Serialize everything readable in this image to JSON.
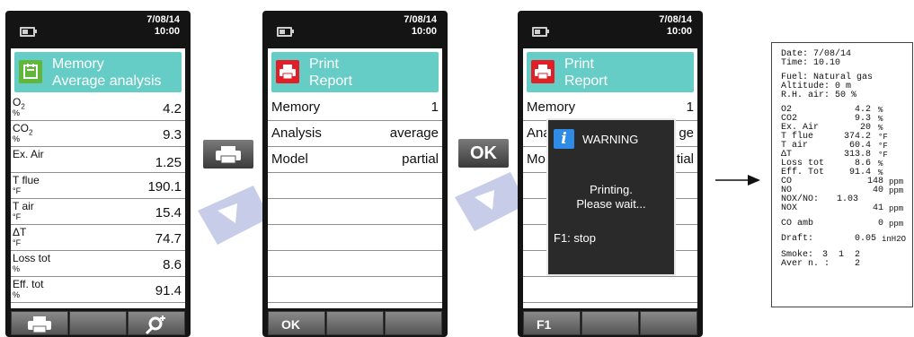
{
  "colors": {
    "accent": "#66cdc6",
    "print_icon_red": "#e01f26",
    "memory_icon_green": "#5fb83a",
    "info_blue": "#2f8be6",
    "device_body": "#141414"
  },
  "screen1": {
    "date": "7/08/14",
    "time": "10:00",
    "title_icon": "memory-icon",
    "title_line1": "Memory",
    "title_line2": "Average analysis",
    "rows": [
      {
        "label": "O",
        "sub": "2",
        "unit": "%",
        "value": "4.2"
      },
      {
        "label": "CO",
        "sub": "2",
        "unit": "%",
        "value": "9.3"
      },
      {
        "label": "Ex. Air",
        "sub": "",
        "unit": "",
        "value": "1.25"
      },
      {
        "label": "T flue",
        "sub": "",
        "unit": "°F",
        "value": "190.1"
      },
      {
        "label": "T air",
        "sub": "",
        "unit": "°F",
        "value": "15.4"
      },
      {
        "label": "ΔT",
        "sub": "",
        "unit": "°F",
        "value": "74.7"
      },
      {
        "label": "Loss tot",
        "sub": "",
        "unit": "%",
        "value": "8.6"
      },
      {
        "label": "Eff. tot",
        "sub": "",
        "unit": "%",
        "value": "91.4"
      }
    ],
    "softkeys": [
      "printer-icon",
      "",
      "zoom-plus-icon"
    ]
  },
  "screen2": {
    "date": "7/08/14",
    "time": "10:00",
    "title_icon": "printer-icon",
    "title_line1": "Print",
    "title_line2": "Report",
    "rows": [
      {
        "label": "Memory",
        "value": "1"
      },
      {
        "label": "Analysis",
        "value": "average"
      },
      {
        "label": "Model",
        "value": "partial"
      }
    ],
    "softkeys": [
      "OK",
      "",
      ""
    ]
  },
  "screen3": {
    "date": "7/08/14",
    "time": "10:00",
    "title_icon": "printer-icon",
    "title_line1": "Print",
    "title_line2": "Report",
    "rows": [
      {
        "label": "Memory",
        "value": "1"
      },
      {
        "label": "Ana",
        "value": "ge"
      },
      {
        "label": "Mo",
        "value": "tial"
      }
    ],
    "warning": {
      "title": "WARNING",
      "line1": "Printing.",
      "line2": "Please wait...",
      "stop": "F1: stop"
    },
    "softkeys": [
      "F1",
      "",
      ""
    ]
  },
  "between_buttons": {
    "print": "printer-icon",
    "ok": "OK"
  },
  "printout": {
    "header": [
      "Date: 7/08/14",
      "Time: 10.10",
      "Fuel: Natural gas",
      "Altitude: 0 m",
      "R.H. air: 50 %"
    ],
    "items": [
      {
        "label": "O2",
        "value": "4.2",
        "unit": "%"
      },
      {
        "label": "CO2",
        "value": "9.3",
        "unit": "%"
      },
      {
        "label": "Ex. Air",
        "value": "20",
        "unit": "%"
      },
      {
        "label": "T flue",
        "value": "374.2",
        "unit": "°F"
      },
      {
        "label": "T air",
        "value": "60.4",
        "unit": "°F"
      },
      {
        "label": "ΔT",
        "value": "313.8",
        "unit": "°F"
      },
      {
        "label": "Loss tot",
        "value": "8.6",
        "unit": "%"
      },
      {
        "label": "Eff. Tot",
        "value": "91.4",
        "unit": "%"
      },
      {
        "label": "CO",
        "value": "148",
        "unit": "ppm"
      },
      {
        "label": "NO",
        "value": "40",
        "unit": "ppm"
      },
      {
        "label": "NOX/NO:",
        "value": "1.03",
        "unit": ""
      },
      {
        "label": "NOX",
        "value": "41",
        "unit": "ppm"
      },
      {
        "label": "CO amb",
        "value": "0",
        "unit": "ppm"
      },
      {
        "label": "Draft:",
        "value": "0.05",
        "unit": "inH2O"
      },
      {
        "label": "Smoke:",
        "value": "3  1  2",
        "unit": ""
      },
      {
        "label": "Aver n. :",
        "value": "2",
        "unit": ""
      }
    ]
  }
}
